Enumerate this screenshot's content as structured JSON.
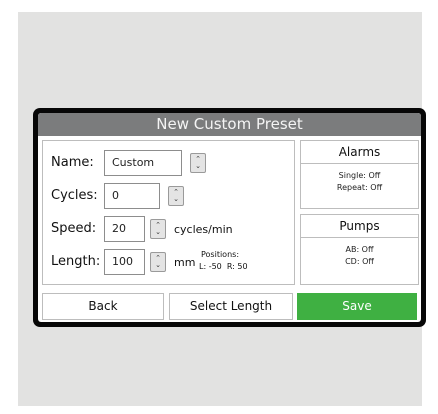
{
  "window": {
    "title": "New Custom Preset"
  },
  "form": {
    "name": {
      "label": "Name:",
      "value": "Custom"
    },
    "cycles": {
      "label": "Cycles:",
      "value": "0"
    },
    "speed": {
      "label": "Speed:",
      "value": "20",
      "unit": "cycles/min"
    },
    "length": {
      "label": "Length:",
      "value": "100",
      "unit": "mm",
      "positions_title": "Positions:",
      "positions_values": "L: -50  R: 50"
    }
  },
  "alarms": {
    "title": "Alarms",
    "single": "Single: Off",
    "repeat": "Repeat: Off"
  },
  "pumps": {
    "title": "Pumps",
    "ab": "AB: Off",
    "cd": "CD: Off"
  },
  "buttons": {
    "back": "Back",
    "select_length": "Select Length",
    "save": "Save"
  },
  "icons": {
    "spinner_up": "chevron-up-icon",
    "spinner_down": "chevron-down-icon"
  },
  "colors": {
    "titlebar": "#7b7c7d",
    "save": "#3fb042",
    "bezel": "#070707",
    "backdrop": "#e2e2e1"
  }
}
